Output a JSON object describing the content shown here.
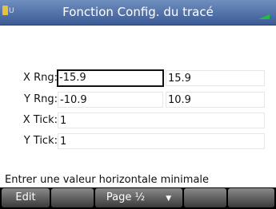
{
  "status": {
    "mode": "U"
  },
  "title": "Fonction Config. du tracé",
  "fields": {
    "xrng": {
      "label": "X Rng:",
      "min": "-15.9",
      "max": "15.9"
    },
    "yrng": {
      "label": "Y Rng:",
      "min": "-10.9",
      "max": "10.9"
    },
    "xtick": {
      "label": "X Tick:",
      "value": "1"
    },
    "ytick": {
      "label": "Y Tick:",
      "value": "1"
    }
  },
  "help_text": "Entrer une valeur horizontale minimale",
  "menu": {
    "edit": "Edit",
    "page": "Page ½",
    "page_arrow": "▼"
  },
  "colors": {
    "title_bar": "#3b5a95",
    "selection_border": "#111111"
  }
}
